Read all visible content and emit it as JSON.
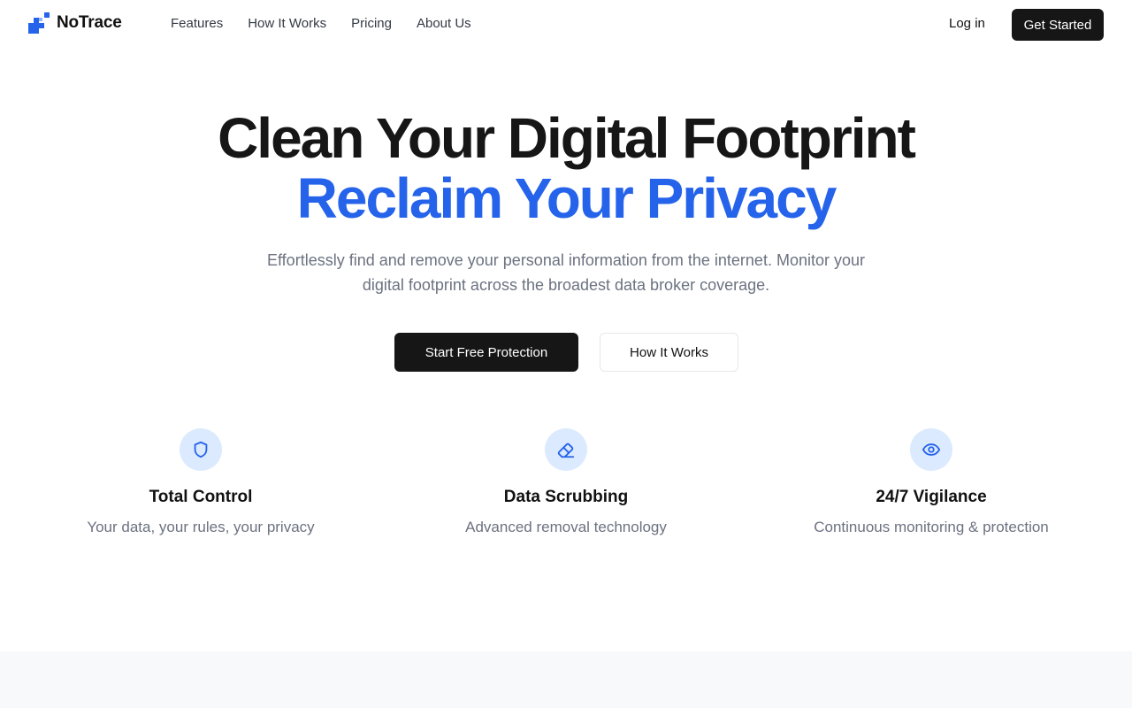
{
  "brand": {
    "name": "NoTrace",
    "accent": "#2563eb"
  },
  "nav": {
    "items": [
      {
        "label": "Features"
      },
      {
        "label": "How It Works"
      },
      {
        "label": "Pricing"
      },
      {
        "label": "About Us"
      }
    ],
    "login_label": "Log in",
    "cta_label": "Get Started"
  },
  "hero": {
    "title": "Clean Your Digital Footprint",
    "title_accent": "Reclaim Your Privacy",
    "subtitle": "Effortlessly find and remove your personal information from the internet. Monitor your digital footprint across the broadest data broker coverage.",
    "primary_button": "Start Free Protection",
    "secondary_button": "How It Works"
  },
  "features": [
    {
      "icon": "shield-icon",
      "title": "Total Control",
      "description": "Your data, your rules, your privacy"
    },
    {
      "icon": "eraser-icon",
      "title": "Data Scrubbing",
      "description": "Advanced removal technology"
    },
    {
      "icon": "eye-icon",
      "title": "24/7 Vigilance",
      "description": "Continuous monitoring & protection"
    }
  ]
}
